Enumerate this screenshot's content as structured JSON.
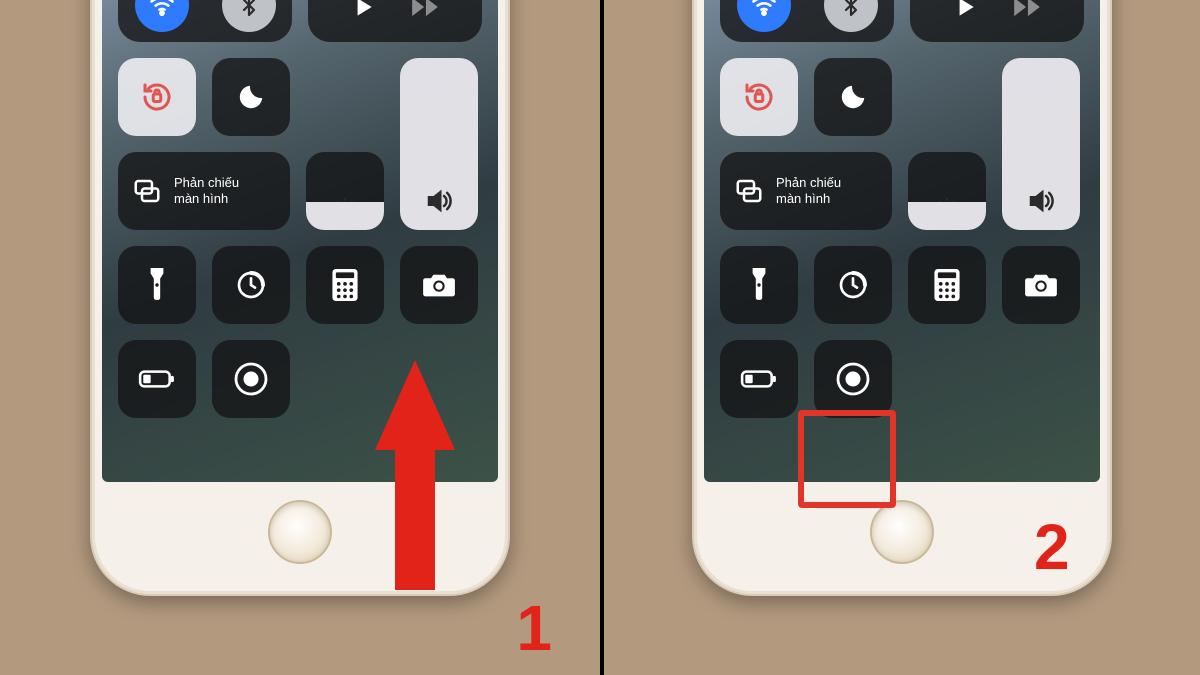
{
  "steps": {
    "one": "1",
    "two": "2"
  },
  "control_center": {
    "mirror_label": "Phản chiếu\nmàn hình",
    "volume_fill_pct": 100,
    "brightness_fill_pct": 36,
    "icons": {
      "wifi": "wifi-icon",
      "bluetooth": "bluetooth-icon",
      "play": "play-icon",
      "next": "next-track-icon",
      "rotation_lock": "rotation-lock-icon",
      "dnd": "do-not-disturb-icon",
      "mirror": "screen-mirror-icon",
      "brightness": "brightness-icon",
      "volume": "volume-icon",
      "flashlight": "flashlight-icon",
      "timer": "timer-icon",
      "calculator": "calculator-icon",
      "camera": "camera-icon",
      "low_power": "low-power-icon",
      "record": "screen-record-icon"
    }
  },
  "annotations": {
    "step1_arrow_color": "#e22319",
    "step2_highlight_target": "screen-record-icon"
  }
}
